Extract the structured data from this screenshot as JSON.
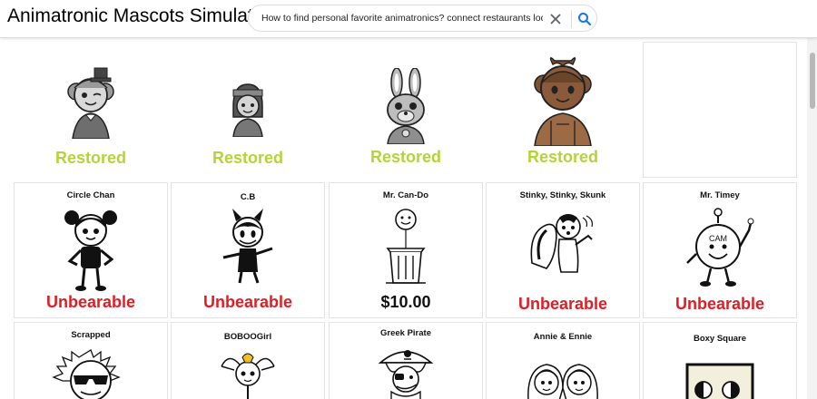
{
  "app": {
    "title": "Animatronic Mascots Simulator"
  },
  "search": {
    "query": "How to find personal favorite animatronics? connect restaurants location",
    "clear_icon": "close-icon",
    "submit_icon": "search-icon"
  },
  "colors": {
    "restored": "#b4d436",
    "unbearable": "#e31b23",
    "price": "#111111",
    "search_icon": "#1a73e8"
  },
  "row1": [
    {
      "status": "Restored",
      "icon": "gray-winking-girl-top-hat"
    },
    {
      "status": "Restored",
      "icon": "gray-girl-with-headband"
    },
    {
      "status": "Restored",
      "icon": "gray-rabbit"
    },
    {
      "status": "Restored",
      "icon": "brown-girl-with-bow"
    },
    {
      "status": "",
      "icon": ""
    }
  ],
  "row2": [
    {
      "name": "Circle Chan",
      "status": "Unbearable",
      "icon": "circle-chan-girl"
    },
    {
      "name": "C.B",
      "status": "Unbearable",
      "icon": "horned-cartoon-devil"
    },
    {
      "name": "Mr. Can-Do",
      "status": "$10.00",
      "icon": "trash-can-balloon"
    },
    {
      "name": "Stinky, Stinky, Skunk",
      "status": "Unbearable",
      "icon": "skunk"
    },
    {
      "name": "Mr. Timey",
      "status": "Unbearable",
      "icon": "clock-character"
    }
  ],
  "row3": [
    {
      "name": "Scrapped",
      "icon": "sun-with-sunglasses"
    },
    {
      "name": "BOBOOGirl",
      "icon": "bow-girl-head"
    },
    {
      "name": "Greek Pirate",
      "icon": "pirate-with-skull-hat"
    },
    {
      "name": "Annie & Ennie",
      "icon": "twin-girls"
    },
    {
      "name": "Boxy Square",
      "icon": "box-character"
    }
  ]
}
